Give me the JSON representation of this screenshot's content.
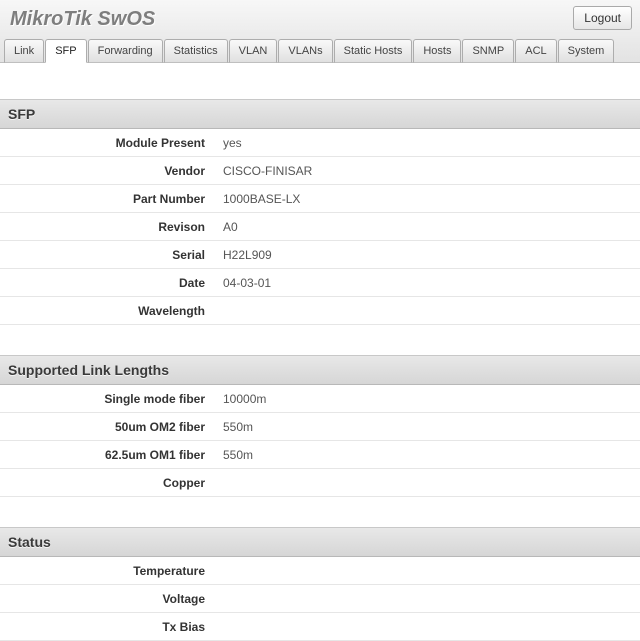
{
  "header": {
    "brand": "MikroTik SwOS",
    "logout_label": "Logout"
  },
  "tabs": [
    {
      "label": "Link",
      "active": false
    },
    {
      "label": "SFP",
      "active": true
    },
    {
      "label": "Forwarding",
      "active": false
    },
    {
      "label": "Statistics",
      "active": false
    },
    {
      "label": "VLAN",
      "active": false
    },
    {
      "label": "VLANs",
      "active": false
    },
    {
      "label": "Static Hosts",
      "active": false
    },
    {
      "label": "Hosts",
      "active": false
    },
    {
      "label": "SNMP",
      "active": false
    },
    {
      "label": "ACL",
      "active": false
    },
    {
      "label": "System",
      "active": false
    }
  ],
  "sections": {
    "sfp": {
      "title": "SFP",
      "rows": [
        {
          "label": "Module Present",
          "value": "yes"
        },
        {
          "label": "Vendor",
          "value": "CISCO-FINISAR"
        },
        {
          "label": "Part Number",
          "value": "1000BASE-LX"
        },
        {
          "label": "Revison",
          "value": "A0"
        },
        {
          "label": "Serial",
          "value": "H22L909"
        },
        {
          "label": "Date",
          "value": "04-03-01"
        },
        {
          "label": "Wavelength",
          "value": ""
        }
      ]
    },
    "link_lengths": {
      "title": "Supported Link Lengths",
      "rows": [
        {
          "label": "Single mode fiber",
          "value": "10000m"
        },
        {
          "label": "50um OM2 fiber",
          "value": "550m"
        },
        {
          "label": "62.5um OM1 fiber",
          "value": "550m"
        },
        {
          "label": "Copper",
          "value": ""
        }
      ]
    },
    "status": {
      "title": "Status",
      "rows": [
        {
          "label": "Temperature",
          "value": ""
        },
        {
          "label": "Voltage",
          "value": ""
        },
        {
          "label": "Tx Bias",
          "value": ""
        }
      ]
    }
  }
}
